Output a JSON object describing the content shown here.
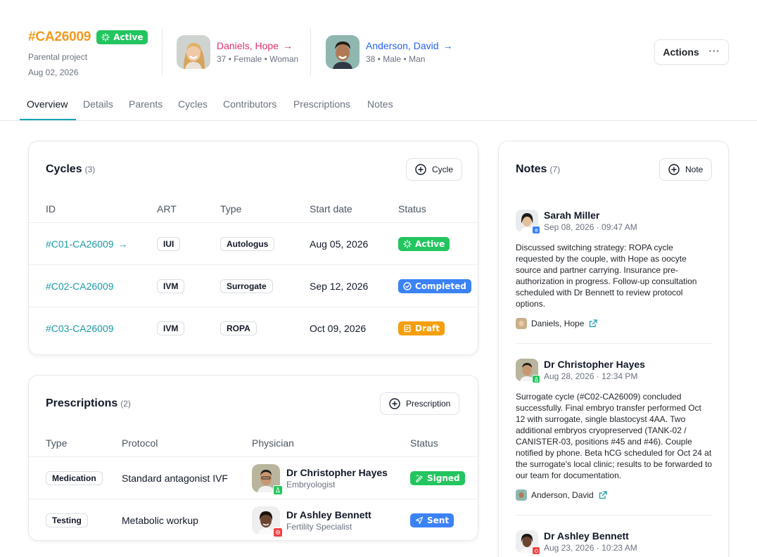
{
  "project": {
    "id": "#CA26009",
    "status": "Active",
    "type": "Parental project",
    "date": "Aug 02, 2026"
  },
  "parents": [
    {
      "name": "Daniels, Hope",
      "meta": "37 • Female • Woman",
      "color": "#e0316d"
    },
    {
      "name": "Anderson, David",
      "meta": "38 • Male • Man",
      "color": "#2563eb"
    }
  ],
  "header": {
    "actions_label": "Actions"
  },
  "tabs": [
    "Overview",
    "Details",
    "Parents",
    "Cycles",
    "Contributors",
    "Prescriptions",
    "Notes"
  ],
  "cycles": {
    "title": "Cycles",
    "count": "(3)",
    "add_label": "Cycle",
    "columns": [
      "ID",
      "ART",
      "Type",
      "Start date",
      "Status"
    ],
    "rows": [
      {
        "id": "#C01-CA26009",
        "art": "IUI",
        "type": "Autologus",
        "start": "Aug 05, 2026",
        "status": "Active"
      },
      {
        "id": "#C02-CA26009",
        "art": "IVM",
        "type": "Surrogate",
        "start": "Sep 12, 2026",
        "status": "Completed"
      },
      {
        "id": "#C03-CA26009",
        "art": "IVM",
        "type": "ROPA",
        "start": "Oct 09, 2026",
        "status": "Draft"
      }
    ]
  },
  "prescriptions": {
    "title": "Prescriptions",
    "count": "(2)",
    "add_label": "Prescription",
    "columns": [
      "Type",
      "Protocol",
      "Physician",
      "Status"
    ],
    "rows": [
      {
        "type": "Medication",
        "protocol": "Standard antagonist IVF",
        "physician": "Dr Christopher Hayes",
        "role": "Embryologist",
        "status": "Signed"
      },
      {
        "type": "Testing",
        "protocol": "Metabolic workup",
        "physician": "Dr Ashley Bennett",
        "role": "Fertility Specialist",
        "status": "Sent"
      }
    ]
  },
  "notes": {
    "title": "Notes",
    "count": "(7)",
    "add_label": "Note",
    "items": [
      {
        "author": "Sarah Miller",
        "time": "Sep 08, 2026 · 09:47 AM",
        "body": "Discussed switching strategy: ROPA cycle requested by the couple, with Hope as oocyte source and partner carrying. Insurance pre-authorization in progress. Follow-up consultation scheduled with Dr Bennett to review protocol options.",
        "ref": "Daniels, Hope"
      },
      {
        "author": "Dr Christopher Hayes",
        "time": "Aug 28, 2026 · 12:34 PM",
        "body": "Surrogate cycle (#C02-CA26009) concluded successfully. Final embryo transfer performed Oct 12 with surrogate, single blastocyst 4AA. Two additional embryos cryopreserved (TANK-02 / CANISTER-03, positions #45 and #46). Couple notified by phone. Beta hCG scheduled for Oct 24 at the surrogate's local clinic; results to be forwarded to our team for documentation.",
        "ref": "Anderson, David"
      },
      {
        "author": "Dr Ashley Bennett",
        "time": "Aug 23, 2026 · 10:23 AM",
        "body": "",
        "ref": ""
      }
    ]
  },
  "colors": {
    "accent": "#14a3b8",
    "project_id": "#f29a1f",
    "active": "#22c55e",
    "completed": "#3b82f6",
    "draft": "#f59e0b"
  }
}
